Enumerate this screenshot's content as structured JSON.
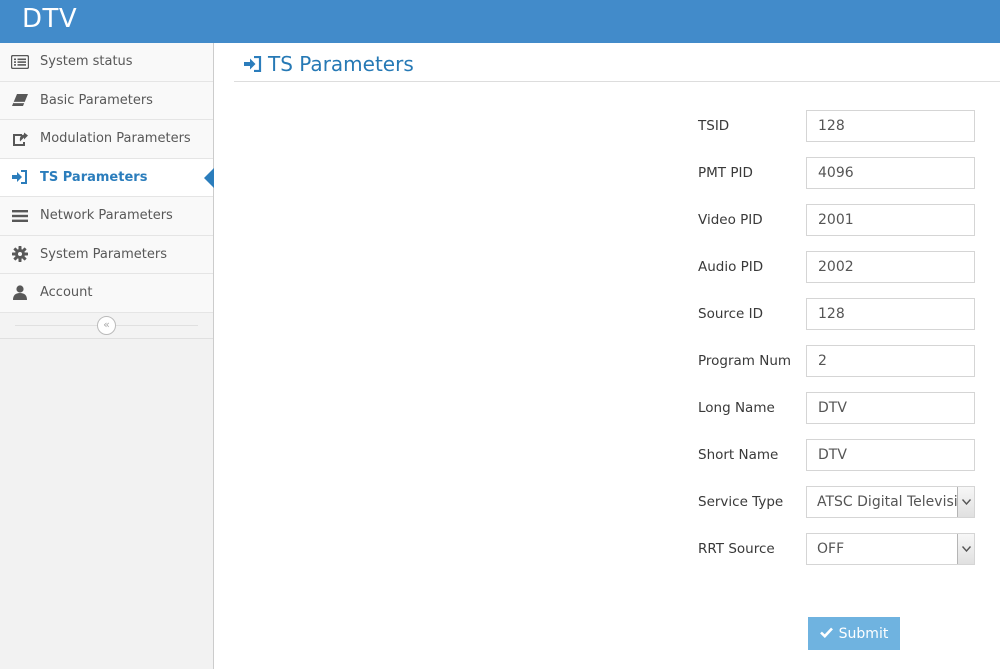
{
  "app": {
    "title": "DTV"
  },
  "sidebar": {
    "items": [
      {
        "label": "System status",
        "icon": "list-alt-icon"
      },
      {
        "label": "Basic Parameters",
        "icon": "eraser-icon"
      },
      {
        "label": "Modulation Parameters",
        "icon": "share-square-icon"
      },
      {
        "label": "TS Parameters",
        "icon": "sign-in-icon",
        "active": true
      },
      {
        "label": "Network Parameters",
        "icon": "bars-icon"
      },
      {
        "label": "System Parameters",
        "icon": "gear-icon"
      },
      {
        "label": "Account",
        "icon": "user-icon"
      }
    ],
    "collapse_icon": "double-angle-left-icon"
  },
  "page": {
    "title": "TS Parameters",
    "icon": "sign-in-icon"
  },
  "form": {
    "tsid": {
      "label": "TSID",
      "value": "128"
    },
    "pmt_pid": {
      "label": "PMT PID",
      "value": "4096"
    },
    "video_pid": {
      "label": "Video PID",
      "value": "2001"
    },
    "audio_pid": {
      "label": "Audio PID",
      "value": "2002"
    },
    "source_id": {
      "label": "Source ID",
      "value": "128"
    },
    "program_num": {
      "label": "Program Num",
      "value": "2"
    },
    "long_name": {
      "label": "Long Name",
      "value": "DTV"
    },
    "short_name": {
      "label": "Short Name",
      "value": "DTV"
    },
    "service_type": {
      "label": "Service Type",
      "value": "ATSC Digital Televisior"
    },
    "rrt_source": {
      "label": "RRT Source",
      "value": "OFF"
    }
  },
  "submit": {
    "label": "Submit",
    "icon": "check-icon"
  },
  "colors": {
    "navbar": "#428bca",
    "accent": "#2b7dbc",
    "header_text": "#2679b5",
    "submit_bg": "#6fb3e0"
  }
}
